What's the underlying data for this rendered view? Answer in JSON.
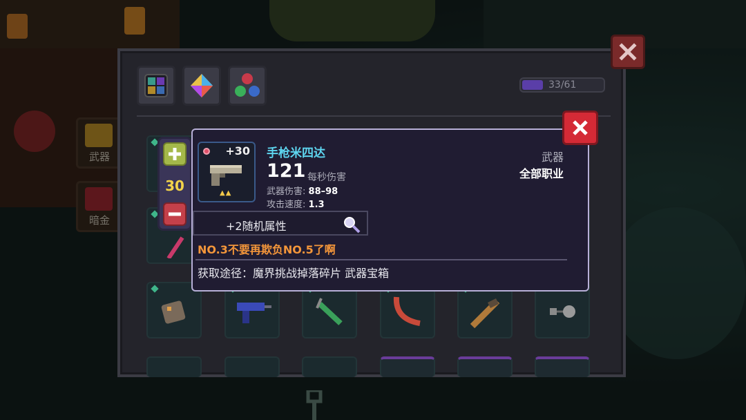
{
  "capacity": {
    "text": "33/61",
    "used": 33,
    "max": 61
  },
  "sidebar": {
    "tabs": [
      {
        "label": "武器"
      },
      {
        "label": "暗金"
      }
    ]
  },
  "stepper": {
    "count": "30"
  },
  "item": {
    "name": "手枪米四达",
    "level": "+30",
    "dps": "121",
    "dps_label": "每秒伤害",
    "damage_label": "武器伤害:",
    "damage_value": "88–98",
    "speed_label": "攻击速度:",
    "speed_value": "1.3",
    "type": "武器",
    "class": "全部职业",
    "stars": "▲▲",
    "random_attr": "+2随机属性",
    "flavor": "NO.3不要再欺负NO.5了啊",
    "source": "获取途径：魔界挑战掉落碎片 武器宝箱"
  },
  "colors": {
    "name": "#5ed6f0",
    "flavor": "#f4963a",
    "stepper_count": "#f2d24a",
    "close_red": "#d42a36"
  },
  "icons": {
    "panel_close": "close-icon",
    "tooltip_close": "close-icon",
    "filters": [
      "grid-filter-icon",
      "gem-filter-icon",
      "orbs-filter-icon"
    ],
    "inspect": "magnifier-icon",
    "plus": "plus-icon",
    "minus": "minus-icon"
  }
}
